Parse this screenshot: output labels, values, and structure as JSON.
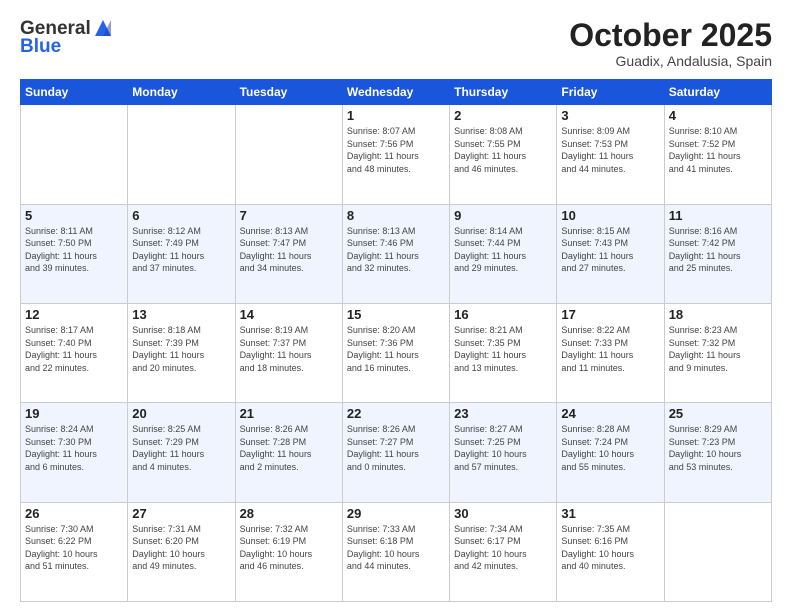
{
  "header": {
    "logo_line1": "General",
    "logo_line2": "Blue",
    "month_title": "October 2025",
    "location": "Guadix, Andalusia, Spain"
  },
  "weekdays": [
    "Sunday",
    "Monday",
    "Tuesday",
    "Wednesday",
    "Thursday",
    "Friday",
    "Saturday"
  ],
  "weeks": [
    [
      {
        "day": "",
        "info": ""
      },
      {
        "day": "",
        "info": ""
      },
      {
        "day": "",
        "info": ""
      },
      {
        "day": "1",
        "info": "Sunrise: 8:07 AM\nSunset: 7:56 PM\nDaylight: 11 hours\nand 48 minutes."
      },
      {
        "day": "2",
        "info": "Sunrise: 8:08 AM\nSunset: 7:55 PM\nDaylight: 11 hours\nand 46 minutes."
      },
      {
        "day": "3",
        "info": "Sunrise: 8:09 AM\nSunset: 7:53 PM\nDaylight: 11 hours\nand 44 minutes."
      },
      {
        "day": "4",
        "info": "Sunrise: 8:10 AM\nSunset: 7:52 PM\nDaylight: 11 hours\nand 41 minutes."
      }
    ],
    [
      {
        "day": "5",
        "info": "Sunrise: 8:11 AM\nSunset: 7:50 PM\nDaylight: 11 hours\nand 39 minutes."
      },
      {
        "day": "6",
        "info": "Sunrise: 8:12 AM\nSunset: 7:49 PM\nDaylight: 11 hours\nand 37 minutes."
      },
      {
        "day": "7",
        "info": "Sunrise: 8:13 AM\nSunset: 7:47 PM\nDaylight: 11 hours\nand 34 minutes."
      },
      {
        "day": "8",
        "info": "Sunrise: 8:13 AM\nSunset: 7:46 PM\nDaylight: 11 hours\nand 32 minutes."
      },
      {
        "day": "9",
        "info": "Sunrise: 8:14 AM\nSunset: 7:44 PM\nDaylight: 11 hours\nand 29 minutes."
      },
      {
        "day": "10",
        "info": "Sunrise: 8:15 AM\nSunset: 7:43 PM\nDaylight: 11 hours\nand 27 minutes."
      },
      {
        "day": "11",
        "info": "Sunrise: 8:16 AM\nSunset: 7:42 PM\nDaylight: 11 hours\nand 25 minutes."
      }
    ],
    [
      {
        "day": "12",
        "info": "Sunrise: 8:17 AM\nSunset: 7:40 PM\nDaylight: 11 hours\nand 22 minutes."
      },
      {
        "day": "13",
        "info": "Sunrise: 8:18 AM\nSunset: 7:39 PM\nDaylight: 11 hours\nand 20 minutes."
      },
      {
        "day": "14",
        "info": "Sunrise: 8:19 AM\nSunset: 7:37 PM\nDaylight: 11 hours\nand 18 minutes."
      },
      {
        "day": "15",
        "info": "Sunrise: 8:20 AM\nSunset: 7:36 PM\nDaylight: 11 hours\nand 16 minutes."
      },
      {
        "day": "16",
        "info": "Sunrise: 8:21 AM\nSunset: 7:35 PM\nDaylight: 11 hours\nand 13 minutes."
      },
      {
        "day": "17",
        "info": "Sunrise: 8:22 AM\nSunset: 7:33 PM\nDaylight: 11 hours\nand 11 minutes."
      },
      {
        "day": "18",
        "info": "Sunrise: 8:23 AM\nSunset: 7:32 PM\nDaylight: 11 hours\nand 9 minutes."
      }
    ],
    [
      {
        "day": "19",
        "info": "Sunrise: 8:24 AM\nSunset: 7:30 PM\nDaylight: 11 hours\nand 6 minutes."
      },
      {
        "day": "20",
        "info": "Sunrise: 8:25 AM\nSunset: 7:29 PM\nDaylight: 11 hours\nand 4 minutes."
      },
      {
        "day": "21",
        "info": "Sunrise: 8:26 AM\nSunset: 7:28 PM\nDaylight: 11 hours\nand 2 minutes."
      },
      {
        "day": "22",
        "info": "Sunrise: 8:26 AM\nSunset: 7:27 PM\nDaylight: 11 hours\nand 0 minutes."
      },
      {
        "day": "23",
        "info": "Sunrise: 8:27 AM\nSunset: 7:25 PM\nDaylight: 10 hours\nand 57 minutes."
      },
      {
        "day": "24",
        "info": "Sunrise: 8:28 AM\nSunset: 7:24 PM\nDaylight: 10 hours\nand 55 minutes."
      },
      {
        "day": "25",
        "info": "Sunrise: 8:29 AM\nSunset: 7:23 PM\nDaylight: 10 hours\nand 53 minutes."
      }
    ],
    [
      {
        "day": "26",
        "info": "Sunrise: 7:30 AM\nSunset: 6:22 PM\nDaylight: 10 hours\nand 51 minutes."
      },
      {
        "day": "27",
        "info": "Sunrise: 7:31 AM\nSunset: 6:20 PM\nDaylight: 10 hours\nand 49 minutes."
      },
      {
        "day": "28",
        "info": "Sunrise: 7:32 AM\nSunset: 6:19 PM\nDaylight: 10 hours\nand 46 minutes."
      },
      {
        "day": "29",
        "info": "Sunrise: 7:33 AM\nSunset: 6:18 PM\nDaylight: 10 hours\nand 44 minutes."
      },
      {
        "day": "30",
        "info": "Sunrise: 7:34 AM\nSunset: 6:17 PM\nDaylight: 10 hours\nand 42 minutes."
      },
      {
        "day": "31",
        "info": "Sunrise: 7:35 AM\nSunset: 6:16 PM\nDaylight: 10 hours\nand 40 minutes."
      },
      {
        "day": "",
        "info": ""
      }
    ]
  ]
}
